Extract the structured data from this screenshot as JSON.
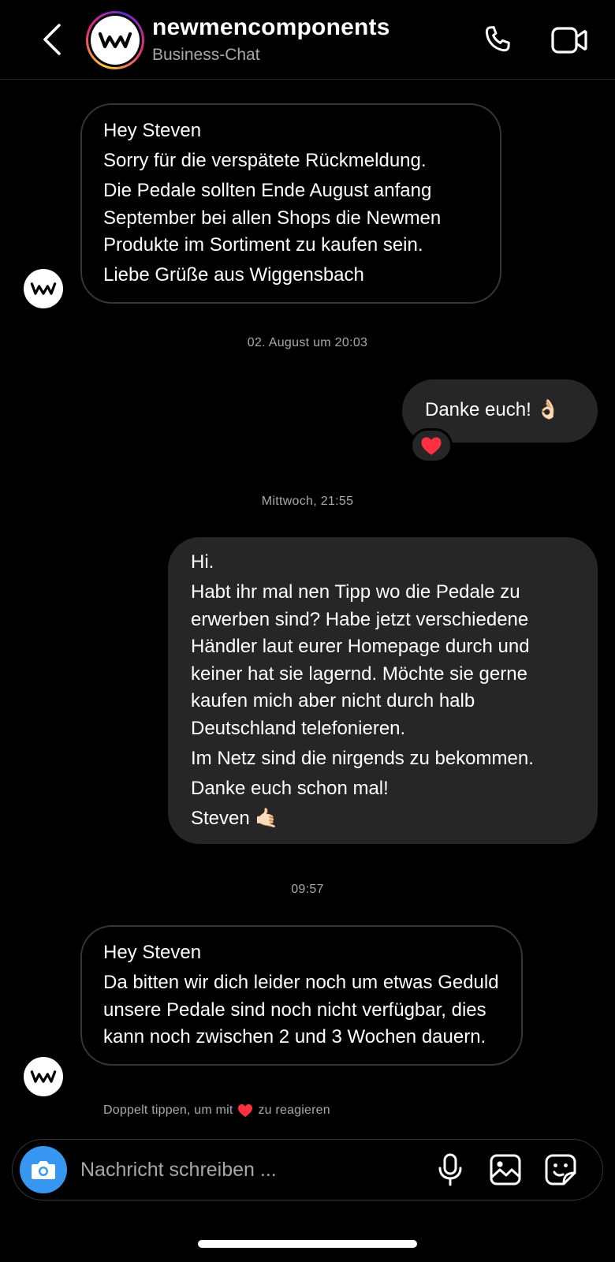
{
  "header": {
    "name": "newmencomponents",
    "subtitle": "Business-Chat"
  },
  "messages": [
    {
      "sender": "newmencomponents",
      "lines": [
        "Hey Steven",
        "Sorry für die verspätete Rückmeldung.",
        "Die Pedale sollten Ende August anfang September bei allen Shops die Newmen Produkte im Sortiment zu kaufen sein.",
        "Liebe Grüße aus Wiggensbach"
      ]
    },
    {
      "sender": "me",
      "lines": [
        "Danke euch! 👌🏻"
      ],
      "reaction": "heart"
    },
    {
      "sender": "me",
      "lines": [
        "Hi.",
        "Habt ihr mal nen Tipp wo die Pedale zu erwerben sind? Habe jetzt verschiedene Händler laut eurer Homepage durch und keiner hat sie lagernd. Möchte sie gerne kaufen mich aber nicht durch halb Deutschland telefonieren.",
        "Im Netz sind die nirgends zu bekommen.",
        "Danke euch schon mal!",
        "Steven 🤙🏻"
      ]
    },
    {
      "sender": "newmencomponents",
      "lines": [
        "Hey Steven",
        "Da bitten wir dich leider noch um etwas Geduld unsere Pedale sind noch nicht verfügbar, dies kann noch zwischen 2 und 3 Wochen dauern."
      ]
    }
  ],
  "timestamps": {
    "t1": "02. August um 20:03",
    "t2": "Mittwoch, 21:55",
    "t3": "09:57"
  },
  "hint": {
    "before": "Doppelt tippen, um mit",
    "after": "zu reagieren"
  },
  "composer": {
    "placeholder": "Nachricht schreiben ..."
  },
  "colors": {
    "background": "#000000",
    "bubble_outgoing": "#262626",
    "bubble_incoming_border": "#363636",
    "accent_blue": "#3797f0",
    "reaction_heart": "#ff3040",
    "secondary_text": "#a8a8a8"
  },
  "icons": [
    "chevron-left-icon",
    "phone-icon",
    "video-camera-icon",
    "camera-icon",
    "microphone-icon",
    "gallery-icon",
    "sticker-icon",
    "heart-icon",
    "newmen-logo"
  ]
}
